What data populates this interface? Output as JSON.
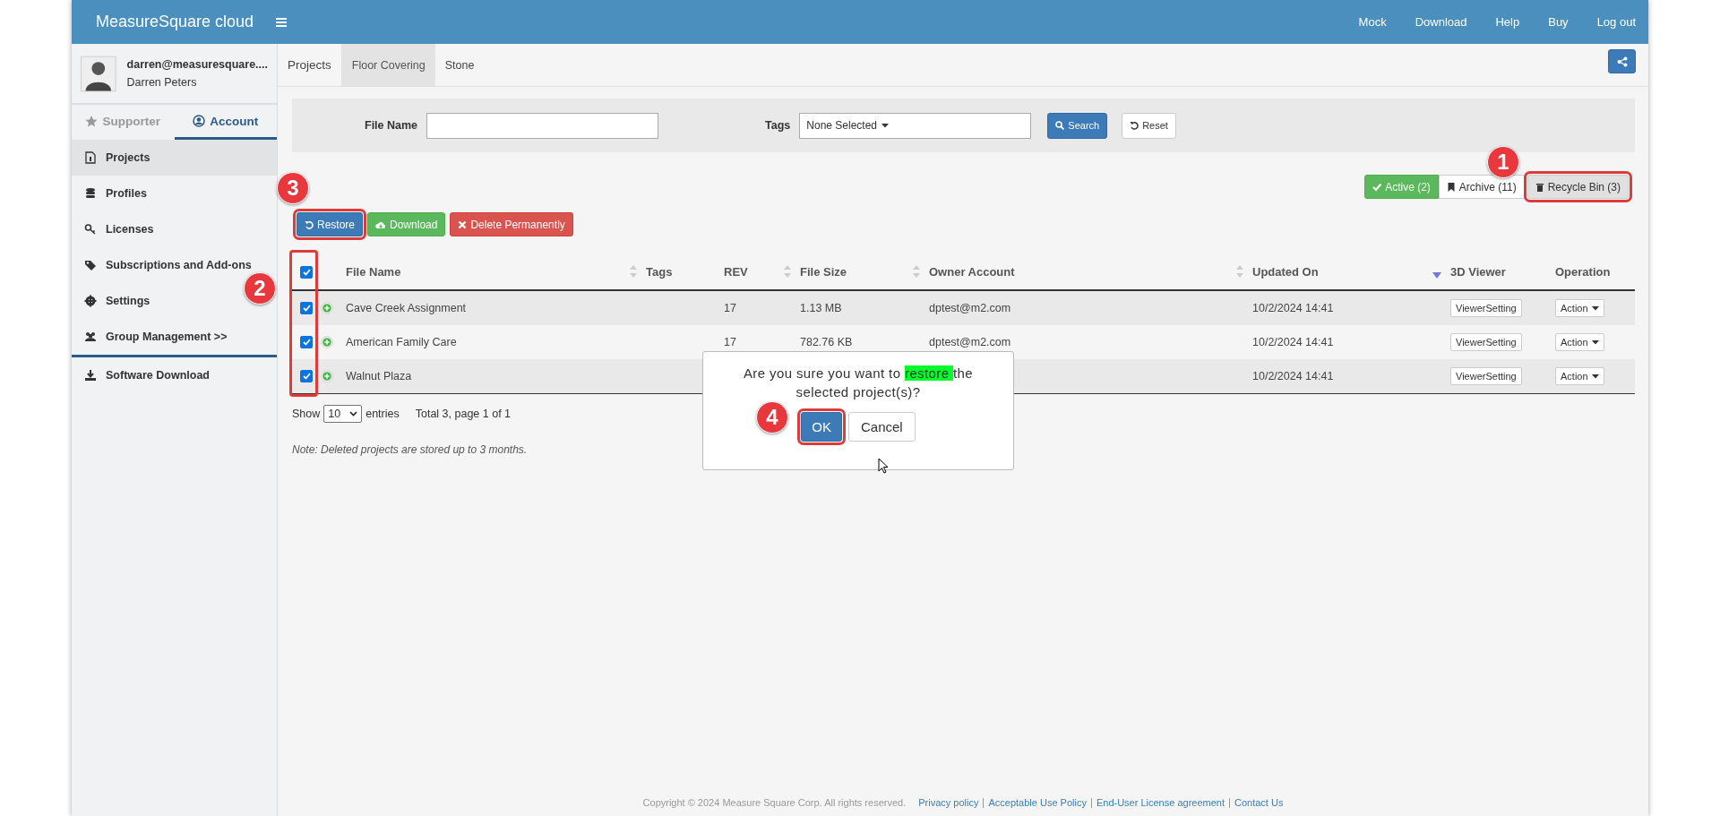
{
  "header": {
    "brand": "MeasureSquare cloud",
    "nav": [
      "Mock",
      "Download",
      "Help",
      "Buy",
      "Log out"
    ]
  },
  "sidebar": {
    "user": {
      "email": "darren@measuresquare....",
      "name": "Darren Peters"
    },
    "tabs": [
      {
        "label": "Supporter",
        "selected": false
      },
      {
        "label": "Account",
        "selected": true
      }
    ],
    "items": [
      {
        "label": "Projects",
        "selected": true
      },
      {
        "label": "Profiles",
        "selected": false
      },
      {
        "label": "Licenses",
        "selected": false
      },
      {
        "label": "Subscriptions and Add-ons",
        "selected": false
      },
      {
        "label": "Settings",
        "selected": false
      },
      {
        "label": "Group Management >>",
        "selected": false
      }
    ],
    "bottom_items": [
      {
        "label": "Software Download",
        "selected": false
      }
    ]
  },
  "subtabs": [
    {
      "label": "Projects",
      "selected": false
    },
    {
      "label": "Floor Covering",
      "selected": true
    },
    {
      "label": "Stone",
      "selected": false
    }
  ],
  "filter": {
    "file_name_label": "File Name",
    "tags_label": "Tags",
    "tags_value": "None Selected",
    "search": "Search",
    "reset": "Reset"
  },
  "status_buttons": [
    {
      "label": "Active (2)",
      "kind": "active",
      "highlighted": false
    },
    {
      "label": "Archive (11)",
      "kind": "archive",
      "highlighted": false
    },
    {
      "label": "Recycle Bin (3)",
      "kind": "recycle",
      "highlighted": true
    }
  ],
  "action_buttons": [
    {
      "label": "Restore",
      "kind": "restore",
      "highlighted": true
    },
    {
      "label": "Download",
      "kind": "download",
      "highlighted": false
    },
    {
      "label": "Delete Permanently",
      "kind": "delete",
      "highlighted": false
    }
  ],
  "table": {
    "select_all_checked": true,
    "checkbox_column_highlighted": true,
    "columns": [
      {
        "label": "File Name",
        "sortable": true,
        "sorted_descending": false
      },
      {
        "label": "Tags",
        "sortable": false,
        "sorted_descending": false
      },
      {
        "label": "REV",
        "sortable": true,
        "sorted_descending": false
      },
      {
        "label": "File Size",
        "sortable": true,
        "sorted_descending": false
      },
      {
        "label": "Owner Account",
        "sortable": true,
        "sorted_descending": false
      },
      {
        "label": "Updated On",
        "sortable": true,
        "sorted_descending": true
      },
      {
        "label": "3D Viewer",
        "sortable": false,
        "sorted_descending": false
      },
      {
        "label": "Operation",
        "sortable": false,
        "sorted_descending": false
      }
    ],
    "rows": [
      {
        "checked": true,
        "file_name": "Cave Creek Assignment",
        "rev": "17",
        "file_size": "1.13 MB",
        "owner": "dptest@m2.com",
        "updated": "10/2/2024 14:41",
        "viewer": "ViewerSetting",
        "operation": "Action"
      },
      {
        "checked": true,
        "file_name": "American Family Care",
        "rev": "17",
        "file_size": "782.76 KB",
        "owner": "dptest@m2.com",
        "updated": "10/2/2024 14:41",
        "viewer": "ViewerSetting",
        "operation": "Action"
      },
      {
        "checked": true,
        "file_name": "Walnut Plaza",
        "updated": "10/2/2024 14:41",
        "viewer": "ViewerSetting",
        "operation": "Action"
      }
    ]
  },
  "paging": {
    "show": "Show",
    "page_size": "10",
    "entries": "entries",
    "total": "Total 3, page 1 of 1"
  },
  "note": "Note: Deleted projects are stored up to 3 months.",
  "dialog": {
    "before": "Are you sure you want to ",
    "highlight": "restore ",
    "after": "the selected project(s)?",
    "buttons": [
      {
        "label": "OK",
        "kind": "primary",
        "highlighted": true
      },
      {
        "label": "Cancel",
        "kind": "default",
        "highlighted": false
      }
    ]
  },
  "footer": {
    "copyright": "Copyright © 2024 Measure Square Corp. All rights reserved.",
    "links": [
      "Privacy policy",
      "Acceptable Use Policy",
      "End-User License agreement",
      "Contact Us"
    ]
  },
  "annotations": [
    {
      "label": "1"
    },
    {
      "label": "2"
    },
    {
      "label": "3"
    },
    {
      "label": "4"
    }
  ]
}
